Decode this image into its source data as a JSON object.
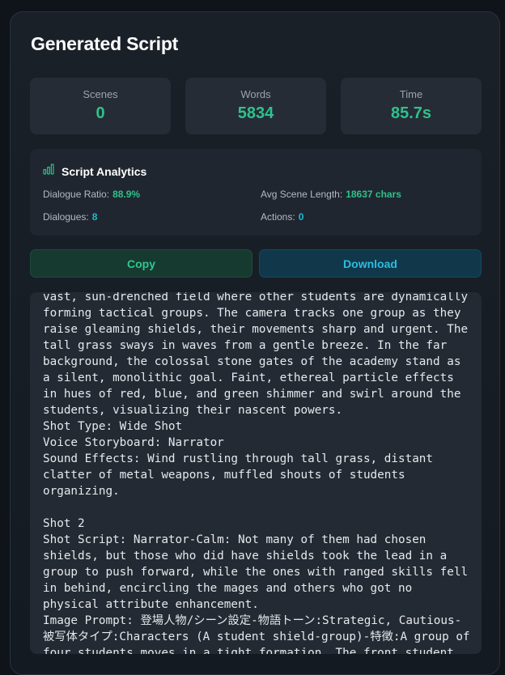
{
  "panel": {
    "title": "Generated Script"
  },
  "stats": {
    "scenes": {
      "label": "Scenes",
      "value": "0"
    },
    "words": {
      "label": "Words",
      "value": "5834"
    },
    "time": {
      "label": "Time",
      "value": "85.7s"
    }
  },
  "analytics": {
    "icon": "bar-chart-icon",
    "title": "Script Analytics",
    "dialogue_ratio": {
      "label": "Dialogue Ratio:",
      "value": "88.9%"
    },
    "avg_scene_length": {
      "label": "Avg Scene Length:",
      "value": "18637 chars"
    },
    "dialogues": {
      "label": "Dialogues:",
      "value": "8"
    },
    "actions": {
      "label": "Actions:",
      "value": "0"
    }
  },
  "buttons": {
    "copy": "Copy",
    "download": "Download"
  },
  "colors": {
    "accent_green": "#2fc18b",
    "accent_cyan": "#22b8cf",
    "background": "#0f141a"
  },
  "script": {
    "text": "vast, sun-drenched field where other students are dynamically forming tactical groups. The camera tracks one group as they raise gleaming shields, their movements sharp and urgent. The tall grass sways in waves from a gentle breeze. In the far background, the colossal stone gates of the academy stand as a silent, monolithic goal. Faint, ethereal particle effects in hues of red, blue, and green shimmer and swirl around the students, visualizing their nascent powers.\nShot Type: Wide Shot\nVoice Storyboard: Narrator\nSound Effects: Wind rustling through tall grass, distant clatter of metal weapons, muffled shouts of students organizing.\n\nShot 2\nShot Script: Narrator-Calm: Not many of them had chosen shields, but those who did have shields took the lead in a group to push forward, while the ones with ranged skills fell in behind, encircling the mages and others who got no physical attribute enhancement.\nImage Prompt: 登場人物/シーン設定-物語トーン:Strategic, Cautious-被写体タイプ:Characters (A student shield-group)-特徴:A group of four students moves in a tight formation. The front student"
  }
}
